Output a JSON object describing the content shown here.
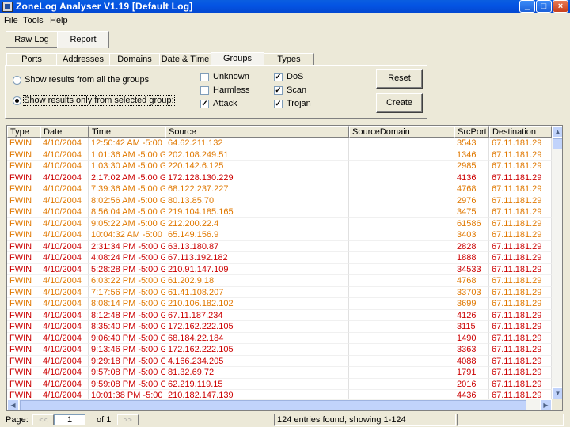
{
  "window": {
    "title": "ZoneLog Analyser V1.19  [Default Log]",
    "controls": [
      "_",
      "□",
      "×"
    ]
  },
  "menu": [
    "File",
    "Tools",
    "Help"
  ],
  "main_tabs": [
    {
      "label": "Raw Log",
      "active": false
    },
    {
      "label": "Report",
      "active": true
    }
  ],
  "sub_tabs": [
    {
      "label": "Ports",
      "active": false
    },
    {
      "label": "Addresses",
      "active": false
    },
    {
      "label": "Domains",
      "active": false
    },
    {
      "label": "Date & Time",
      "active": false
    },
    {
      "label": "Groups",
      "active": true
    },
    {
      "label": "Types",
      "active": false
    }
  ],
  "group_options": {
    "radio_all": "Show results from all the groups",
    "radio_selected": "Show results only from selected group:",
    "selected": "radio_selected"
  },
  "checkboxes": [
    {
      "label": "Unknown",
      "checked": false
    },
    {
      "label": "Harmless",
      "checked": false
    },
    {
      "label": "Attack",
      "checked": true
    },
    {
      "label": "DoS",
      "checked": true
    },
    {
      "label": "Scan",
      "checked": true
    },
    {
      "label": "Trojan",
      "checked": true
    }
  ],
  "buttons": {
    "reset": "Reset",
    "create": "Create"
  },
  "table": {
    "columns": [
      "Type",
      "Date",
      "Time",
      "Source",
      "SourceDomain",
      "SrcPort",
      "Destination"
    ],
    "rows": [
      {
        "type": "FWIN",
        "date": "4/10/2004",
        "time": "12:50:42 AM -5:00 GI",
        "source": "64.62.211.132",
        "domain": "",
        "srcport": "3543",
        "dest": "67.11.181.29",
        "color": "orange"
      },
      {
        "type": "FWIN",
        "date": "4/10/2004",
        "time": "1:01:36 AM -5:00 GM",
        "source": "202.108.249.51",
        "domain": "",
        "srcport": "1346",
        "dest": "67.11.181.29",
        "color": "orange"
      },
      {
        "type": "FWIN",
        "date": "4/10/2004",
        "time": "1:03:30 AM -5:00 GM",
        "source": "220.142.6.125",
        "domain": "",
        "srcport": "2985",
        "dest": "67.11.181.29",
        "color": "orange"
      },
      {
        "type": "FWIN",
        "date": "4/10/2004",
        "time": "2:17:02 AM -5:00 GM",
        "source": "172.128.130.229",
        "domain": "",
        "srcport": "4136",
        "dest": "67.11.181.29",
        "color": "red"
      },
      {
        "type": "FWIN",
        "date": "4/10/2004",
        "time": "7:39:36 AM -5:00 GM",
        "source": "68.122.237.227",
        "domain": "",
        "srcport": "4768",
        "dest": "67.11.181.29",
        "color": "orange"
      },
      {
        "type": "FWIN",
        "date": "4/10/2004",
        "time": "8:02:56 AM -5:00 GM",
        "source": "80.13.85.70",
        "domain": "",
        "srcport": "2976",
        "dest": "67.11.181.29",
        "color": "orange"
      },
      {
        "type": "FWIN",
        "date": "4/10/2004",
        "time": "8:56:04 AM -5:00 GM",
        "source": "219.104.185.165",
        "domain": "",
        "srcport": "3475",
        "dest": "67.11.181.29",
        "color": "orange"
      },
      {
        "type": "FWIN",
        "date": "4/10/2004",
        "time": "9:05:22 AM -5:00 GM",
        "source": "212.200.22.4",
        "domain": "",
        "srcport": "61586",
        "dest": "67.11.181.29",
        "color": "orange"
      },
      {
        "type": "FWIN",
        "date": "4/10/2004",
        "time": "10:04:32 AM -5:00 GI",
        "source": "65.149.156.9",
        "domain": "",
        "srcport": "3403",
        "dest": "67.11.181.29",
        "color": "orange"
      },
      {
        "type": "FWIN",
        "date": "4/10/2004",
        "time": "2:31:34 PM -5:00 GM",
        "source": "63.13.180.87",
        "domain": "",
        "srcport": "2828",
        "dest": "67.11.181.29",
        "color": "red"
      },
      {
        "type": "FWIN",
        "date": "4/10/2004",
        "time": "4:08:24 PM -5:00 GM",
        "source": "67.113.192.182",
        "domain": "",
        "srcport": "1888",
        "dest": "67.11.181.29",
        "color": "red"
      },
      {
        "type": "FWIN",
        "date": "4/10/2004",
        "time": "5:28:28 PM -5:00 GM",
        "source": "210.91.147.109",
        "domain": "",
        "srcport": "34533",
        "dest": "67.11.181.29",
        "color": "red"
      },
      {
        "type": "FWIN",
        "date": "4/10/2004",
        "time": "6:03:22 PM -5:00 GM",
        "source": "61.202.9.18",
        "domain": "",
        "srcport": "4768",
        "dest": "67.11.181.29",
        "color": "orange"
      },
      {
        "type": "FWIN",
        "date": "4/10/2004",
        "time": "7:17:56 PM -5:00 GM",
        "source": "61.41.108.207",
        "domain": "",
        "srcport": "33703",
        "dest": "67.11.181.29",
        "color": "orange"
      },
      {
        "type": "FWIN",
        "date": "4/10/2004",
        "time": "8:08:14 PM -5:00 GM",
        "source": "210.106.182.102",
        "domain": "",
        "srcport": "3699",
        "dest": "67.11.181.29",
        "color": "orange"
      },
      {
        "type": "FWIN",
        "date": "4/10/2004",
        "time": "8:12:48 PM -5:00 GM",
        "source": "67.11.187.234",
        "domain": "",
        "srcport": "4126",
        "dest": "67.11.181.29",
        "color": "red"
      },
      {
        "type": "FWIN",
        "date": "4/10/2004",
        "time": "8:35:40 PM -5:00 GM",
        "source": "172.162.222.105",
        "domain": "",
        "srcport": "3115",
        "dest": "67.11.181.29",
        "color": "red"
      },
      {
        "type": "FWIN",
        "date": "4/10/2004",
        "time": "9:06:40 PM -5:00 GM",
        "source": "68.184.22.184",
        "domain": "",
        "srcport": "1490",
        "dest": "67.11.181.29",
        "color": "red"
      },
      {
        "type": "FWIN",
        "date": "4/10/2004",
        "time": "9:13:46 PM -5:00 GM",
        "source": "172.162.222.105",
        "domain": "",
        "srcport": "3363",
        "dest": "67.11.181.29",
        "color": "red"
      },
      {
        "type": "FWIN",
        "date": "4/10/2004",
        "time": "9:29:18 PM -5:00 GM",
        "source": "4.166.234.205",
        "domain": "",
        "srcport": "4088",
        "dest": "67.11.181.29",
        "color": "red"
      },
      {
        "type": "FWIN",
        "date": "4/10/2004",
        "time": "9:57:08 PM -5:00 GM",
        "source": "81.32.69.72",
        "domain": "",
        "srcport": "1791",
        "dest": "67.11.181.29",
        "color": "red"
      },
      {
        "type": "FWIN",
        "date": "4/10/2004",
        "time": "9:59:08 PM -5:00 GM",
        "source": "62.219.119.15",
        "domain": "",
        "srcport": "2016",
        "dest": "67.11.181.29",
        "color": "red"
      },
      {
        "type": "FWIN",
        "date": "4/10/2004",
        "time": "10:01:38 PM -5:00 GI",
        "source": "210.182.147.139",
        "domain": "",
        "srcport": "4436",
        "dest": "67.11.181.29",
        "color": "red"
      }
    ]
  },
  "status": {
    "page_label": "Page:",
    "prev": "<<",
    "page_value": "1",
    "of_label": "of 1",
    "next": ">>",
    "summary": "124 entries found, showing 1-124"
  },
  "colors": {
    "orange": "#e07800",
    "red": "#cc0000",
    "titlebar": "#0454e3"
  }
}
